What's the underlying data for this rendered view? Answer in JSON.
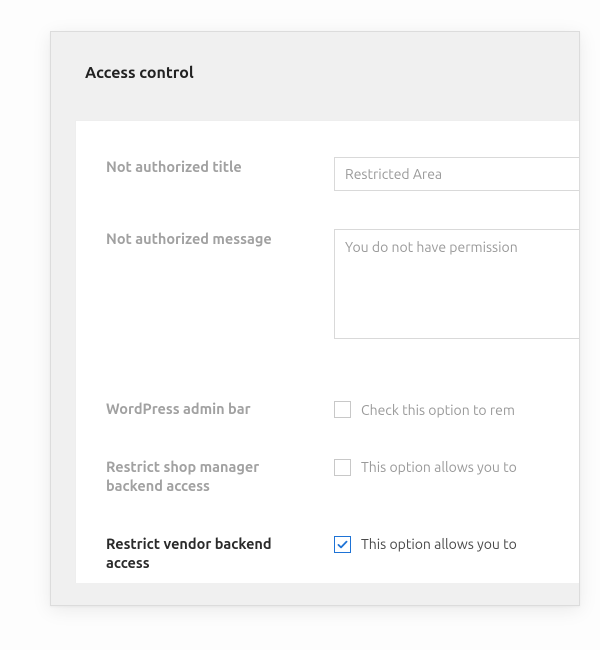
{
  "section_title": "Access control",
  "fields": {
    "not_authorized_title": {
      "label": "Not authorized title",
      "value": "Restricted Area"
    },
    "not_authorized_message": {
      "label": "Not authorized message",
      "value": "You do not have permission"
    },
    "wp_admin_bar": {
      "label": "WordPress admin bar",
      "checked": false,
      "desc": "Check this option to rem"
    },
    "restrict_shop_manager": {
      "label": "Restrict shop manager backend access",
      "checked": false,
      "desc": "This option allows you to"
    },
    "restrict_vendor": {
      "label": "Restrict vendor backend access",
      "checked": true,
      "desc": "This option allows you to"
    }
  }
}
